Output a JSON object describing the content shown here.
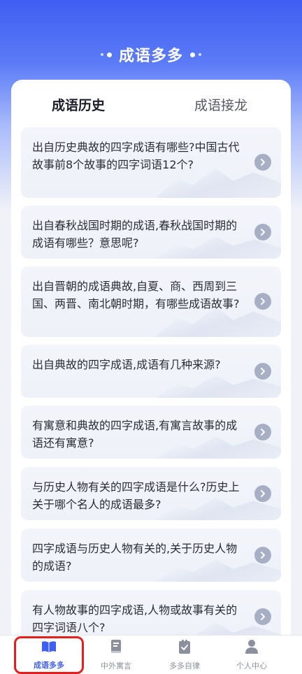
{
  "header": {
    "title": "成语多多"
  },
  "tabs": [
    {
      "label": "成语历史",
      "active": true
    },
    {
      "label": "成语接龙",
      "active": false
    }
  ],
  "questions": [
    {
      "text": "出自历史典故的四字成语有哪些?中国古代故事前8个故事的四字词语12个?"
    },
    {
      "text": "出自春秋战国时期的成语,春秋战国时期的成语有哪些？意思呢?"
    },
    {
      "text": "出自晋朝的成语典故,自夏、商、西周到三国、两晋、南北朝时期，有哪些成语故事?"
    },
    {
      "text": "出自典故的四字成语,成语有几种来源?"
    },
    {
      "text": "有寓意和典故的四字成语,有寓言故事的成语还有寓意?"
    },
    {
      "text": "与历史人物有关的四字成语是什么?历史上关于哪个名人的成语最多?"
    },
    {
      "text": "四字成语与历史人物有关的,关于历史人物的成语?"
    },
    {
      "text": "有人物故事的四字成语,人物或故事有关的四字词语八个?"
    }
  ],
  "tabbar": [
    {
      "label": "成语多多",
      "icon": "open-book-icon",
      "active": true
    },
    {
      "label": "中外寓言",
      "icon": "closed-book-icon",
      "active": false
    },
    {
      "label": "多多自律",
      "icon": "checklist-icon",
      "active": false
    },
    {
      "label": "个人中心",
      "icon": "person-icon",
      "active": false
    }
  ],
  "colors": {
    "primary": "#3f5ef2",
    "highlight": "#e61e1e",
    "arrow_bg": "#a7afc4"
  }
}
